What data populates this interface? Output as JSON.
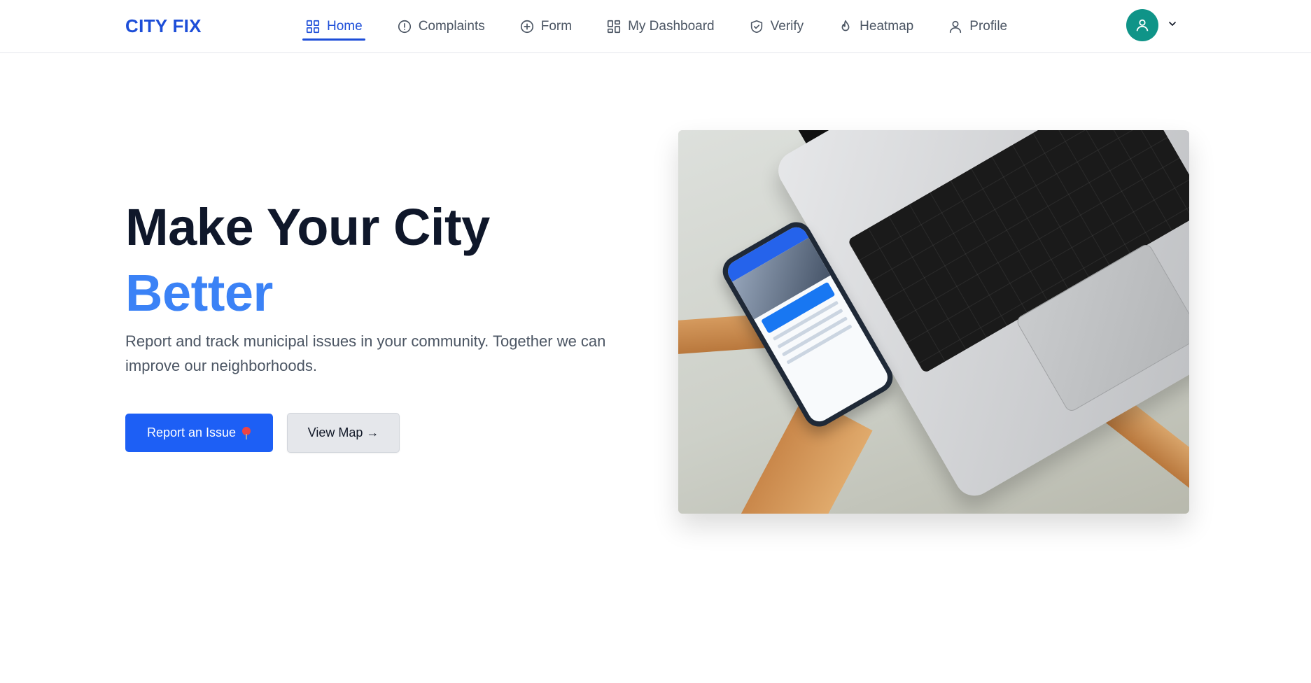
{
  "brand": {
    "name": "CITY FIX",
    "color": "#1d4ed8"
  },
  "nav": {
    "items": [
      {
        "label": "Home",
        "icon": "grid-icon",
        "active": true
      },
      {
        "label": "Complaints",
        "icon": "alert-circle-icon",
        "active": false
      },
      {
        "label": "Form",
        "icon": "plus-circle-icon",
        "active": false
      },
      {
        "label": "My Dashboard",
        "icon": "dashboard-icon",
        "active": false
      },
      {
        "label": "Verify",
        "icon": "shield-check-icon",
        "active": false
      },
      {
        "label": "Heatmap",
        "icon": "flame-icon",
        "active": false
      },
      {
        "label": "Profile",
        "icon": "user-icon",
        "active": false
      }
    ]
  },
  "user": {
    "avatar_icon": "user-icon",
    "avatar_color": "#0f9488",
    "menu_icon": "chevron-down-icon"
  },
  "hero": {
    "title_line1": "Make Your City",
    "title_line2": "Better",
    "subtitle": "Report and track municipal issues in your community. Together we can improve our neighborhoods.",
    "primary_button": "Report an Issue",
    "primary_button_icon": "map-pin-icon",
    "secondary_button": "View Map →",
    "image_icon": "laptop-and-phone-photo"
  },
  "colors": {
    "accent": "#3b82f6",
    "primary_button": "#1d5ff5",
    "title": "#0f172a",
    "text": "#4b5563"
  }
}
